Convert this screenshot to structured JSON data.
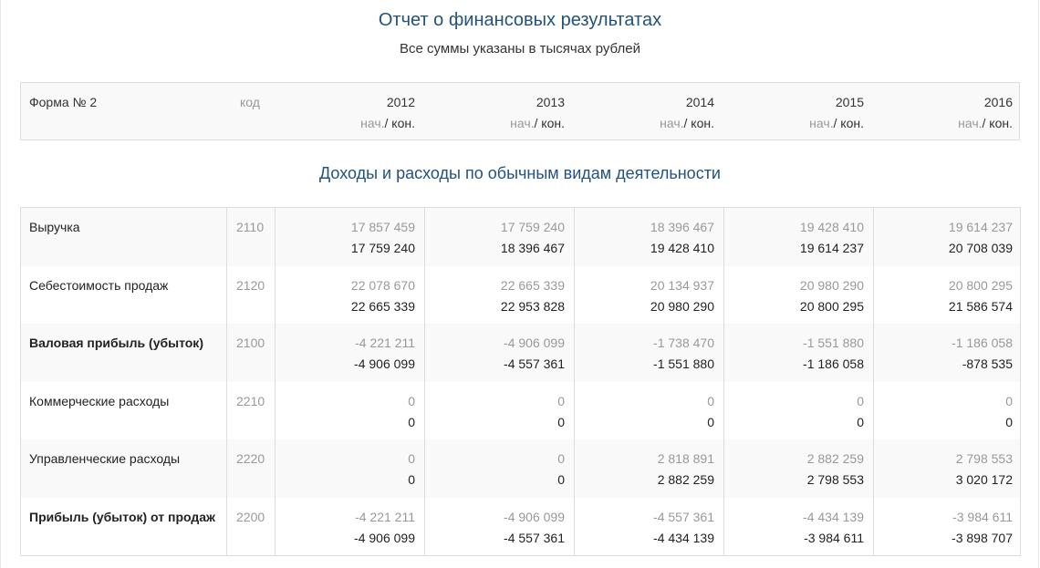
{
  "page": {
    "title": "Отчет о финансовых результатах",
    "subtitle": "Все суммы указаны в тысячах рублей"
  },
  "header": {
    "form_label": "Форма № 2",
    "code_label": "код",
    "begin_label": "нач.",
    "separator": "/",
    "end_label": "кон.",
    "years": [
      "2012",
      "2013",
      "2014",
      "2015",
      "2016"
    ]
  },
  "section": {
    "title": "Доходы и расходы по обычным видам деятельности"
  },
  "rows": [
    {
      "label": "Выручка",
      "code": "2110",
      "bold": false,
      "begin": [
        "17 857 459",
        "17 759 240",
        "18 396 467",
        "19 428 410",
        "19 614 237"
      ],
      "end": [
        "17 759 240",
        "18 396 467",
        "19 428 410",
        "19 614 237",
        "20 708 039"
      ]
    },
    {
      "label": "Себестоимость продаж",
      "code": "2120",
      "bold": false,
      "begin": [
        "22 078 670",
        "22 665 339",
        "20 134 937",
        "20 980 290",
        "20 800 295"
      ],
      "end": [
        "22 665 339",
        "22 953 828",
        "20 980 290",
        "20 800 295",
        "21 586 574"
      ]
    },
    {
      "label": "Валовая прибыль (убыток)",
      "code": "2100",
      "bold": true,
      "begin": [
        "-4 221 211",
        "-4 906 099",
        "-1 738 470",
        "-1 551 880",
        "-1 186 058"
      ],
      "end": [
        "-4 906 099",
        "-4 557 361",
        "-1 551 880",
        "-1 186 058",
        "-878 535"
      ]
    },
    {
      "label": "Коммерческие расходы",
      "code": "2210",
      "bold": false,
      "begin": [
        "0",
        "0",
        "0",
        "0",
        "0"
      ],
      "end": [
        "0",
        "0",
        "0",
        "0",
        "0"
      ]
    },
    {
      "label": "Управленческие расходы",
      "code": "2220",
      "bold": false,
      "begin": [
        "0",
        "0",
        "2 818 891",
        "2 882 259",
        "2 798 553"
      ],
      "end": [
        "0",
        "0",
        "2 882 259",
        "2 798 553",
        "3 020 172"
      ]
    },
    {
      "label": "Прибыль (убыток) от продаж",
      "code": "2200",
      "bold": true,
      "begin": [
        "-4 221 211",
        "-4 906 099",
        "-4 557 361",
        "-4 434 139",
        "-3 984 611"
      ],
      "end": [
        "-4 906 099",
        "-4 557 361",
        "-4 434 139",
        "-3 984 611",
        "-3 898 707"
      ]
    }
  ]
}
